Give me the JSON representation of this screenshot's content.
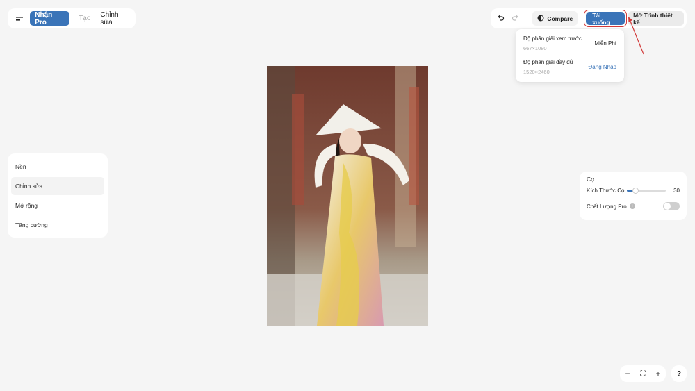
{
  "header": {
    "get_pro_label": "Nhận Pro",
    "tabs": [
      {
        "label": "Tạo",
        "state": "disabled"
      },
      {
        "label": "Chỉnh sửa",
        "state": "active"
      }
    ]
  },
  "toolbar": {
    "compare_label": "Compare",
    "download_label": "Tải xuống",
    "open_designer_label": "Mở Trình thiết kế"
  },
  "download_menu": {
    "options": [
      {
        "title": "Độ phân giải xem trước",
        "resolution": "667×1080",
        "action": "Miễn Phí"
      },
      {
        "title": "Độ phân giải đầy đủ",
        "resolution": "1520×2460",
        "action": "Đăng Nhập"
      }
    ]
  },
  "sidebar": {
    "items": [
      {
        "label": "Nền"
      },
      {
        "label": "Chỉnh sửa",
        "active": true
      },
      {
        "label": "Mở rộng"
      },
      {
        "label": "Tăng cường"
      }
    ]
  },
  "brush_panel": {
    "title": "Cọ",
    "size_label": "Kích Thước Cọ",
    "size_value": "30",
    "size_slider_fraction": 0.2,
    "quality_label": "Chất Lượng Pro",
    "quality_enabled": false
  },
  "zoom_controls": {
    "zoom_out": "−",
    "fit": "⛶",
    "zoom_in": "+",
    "help": "?"
  },
  "colors": {
    "accent": "#3a74b8",
    "highlight": "#d23a3a",
    "background": "#f5f5f5"
  }
}
